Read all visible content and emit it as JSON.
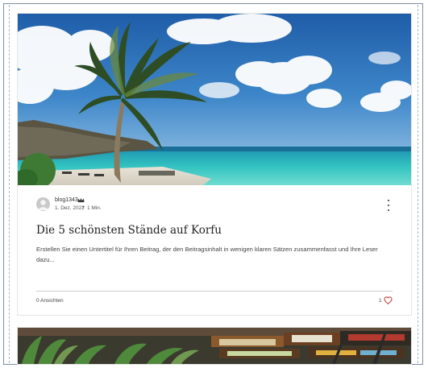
{
  "post": {
    "author": "blog1343",
    "date": "1. Dez. 2022",
    "separator": "•",
    "read_time": "1 Min.",
    "title": "Die 5 schönsten Stände auf Korfu",
    "excerpt": "Erstellen Sie einen Untertitel für Ihren Beitrag, der den Beitragsinhalt in wenigen klaren Sätzen zusammenfasst und Ihre Leser dazu...",
    "views": "0 Ansichten",
    "likes": "1",
    "hero_image": "tropical-beach-palm-tree",
    "icons": {
      "more": "more-vertical-icon",
      "heart": "heart-icon",
      "crown": "crown-icon"
    }
  },
  "next_post": {
    "image": "floating-market-boats"
  },
  "colors": {
    "heart": "#c0392b",
    "sea": "#2fb7b0",
    "sky": "#2c6fb8"
  }
}
